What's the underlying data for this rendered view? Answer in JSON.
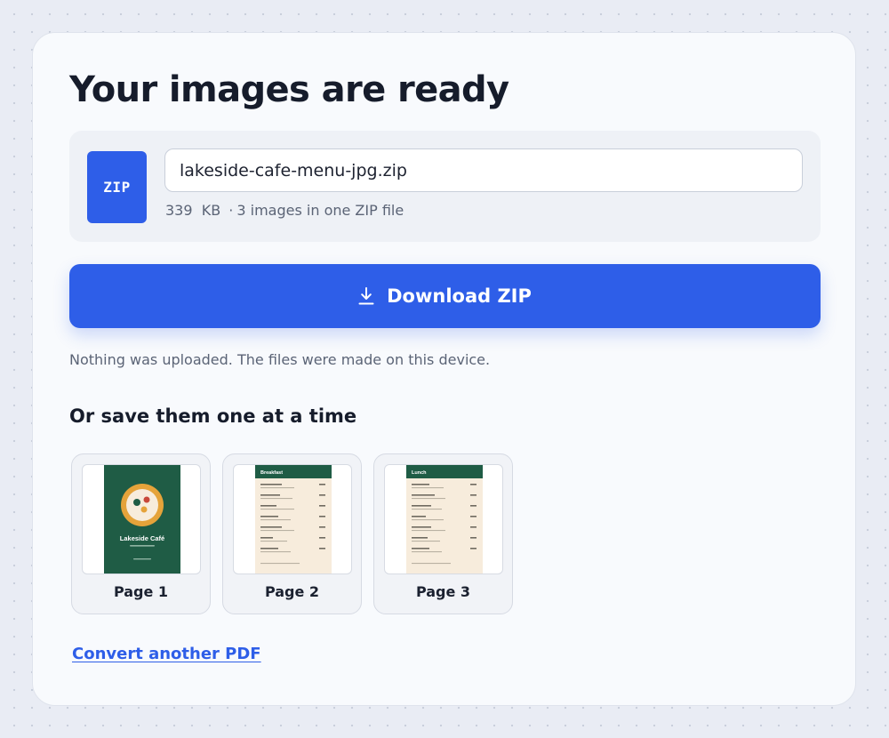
{
  "page": {
    "title": "Your images are ready"
  },
  "file": {
    "badge": "ZIP",
    "filename": "lakeside-cafe-menu-jpg.zip",
    "size": "339  KB",
    "separator": "·",
    "description": "3 images in one ZIP file"
  },
  "download": {
    "label": "Download ZIP",
    "icon": "download-icon"
  },
  "privacy_note": "Nothing was uploaded. The files were made on this device.",
  "individual": {
    "heading": "Or save them one at a time",
    "pages": [
      {
        "label": "Page 1",
        "cover_title": "Lakeside Café"
      },
      {
        "label": "Page 2",
        "section_title": "Breakfast"
      },
      {
        "label": "Page 3",
        "section_title": "Lunch"
      }
    ]
  },
  "convert_link": "Convert another PDF",
  "colors": {
    "accent": "#2e5ee8",
    "menu_green": "#1f5c45",
    "menu_cream": "#f7ecdc",
    "logo_gold": "#e5a33a"
  }
}
